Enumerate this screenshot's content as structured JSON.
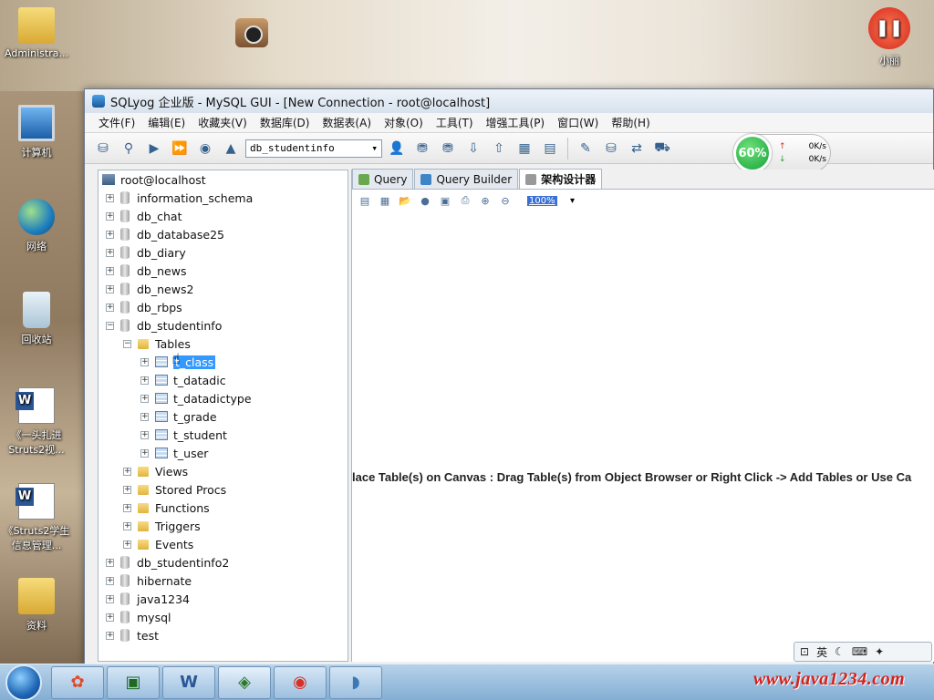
{
  "desktop": {
    "icons": [
      {
        "label": "Administra...",
        "icon": "folder-user-icon"
      },
      {
        "label": "计算机",
        "icon": "computer-icon"
      },
      {
        "label": "网络",
        "icon": "network-icon"
      },
      {
        "label": "回收站",
        "icon": "recycle-bin-icon"
      },
      {
        "label": "《一头扎进Struts2视...",
        "icon": "word-doc-icon"
      },
      {
        "label": "《Struts2学生信息管理...",
        "icon": "word-doc-icon"
      },
      {
        "label": "资料",
        "icon": "folder-icon"
      },
      {
        "label": "小丽",
        "icon": "pause-app-icon"
      }
    ]
  },
  "window": {
    "title": "SQLyog 企业版 - MySQL GUI - [New Connection - root@localhost]",
    "menu": [
      "文件(F)",
      "编辑(E)",
      "收藏夹(V)",
      "数据库(D)",
      "数据表(A)",
      "对象(O)",
      "工具(T)",
      "增强工具(P)",
      "窗口(W)",
      "帮助(H)"
    ],
    "toolbar": {
      "database_select": "db_studentinfo"
    },
    "net_widget": {
      "percent": "60%",
      "up_rate": "0K/s",
      "down_rate": "0K/s",
      "up_arrow": "↑",
      "down_arrow": "↓"
    }
  },
  "tree": {
    "root": "root@localhost",
    "databases_before": [
      "information_schema",
      "db_chat",
      "db_database25",
      "db_diary",
      "db_news",
      "db_news2",
      "db_rbps"
    ],
    "expanded_db": "db_studentinfo",
    "tables_folder": "Tables",
    "tables": [
      "t_class",
      "t_datadic",
      "t_datadictype",
      "t_grade",
      "t_student",
      "t_user"
    ],
    "selected_table": "t_class",
    "other_folders": [
      "Views",
      "Stored Procs",
      "Functions",
      "Triggers",
      "Events"
    ],
    "databases_after": [
      "db_studentinfo2",
      "hibernate",
      "java1234",
      "mysql",
      "test"
    ]
  },
  "tabs": [
    {
      "label": "Query",
      "active": false
    },
    {
      "label": "Query Builder",
      "active": false
    },
    {
      "label": "架构设计器",
      "active": true
    }
  ],
  "schema": {
    "zoom": "100%",
    "hint": "lace Table(s) on Canvas : Drag Table(s) from Object Browser or Right Click -> Add Tables or Use Ca"
  },
  "ime": {
    "label": "英"
  },
  "watermark": "www.java1234.com"
}
